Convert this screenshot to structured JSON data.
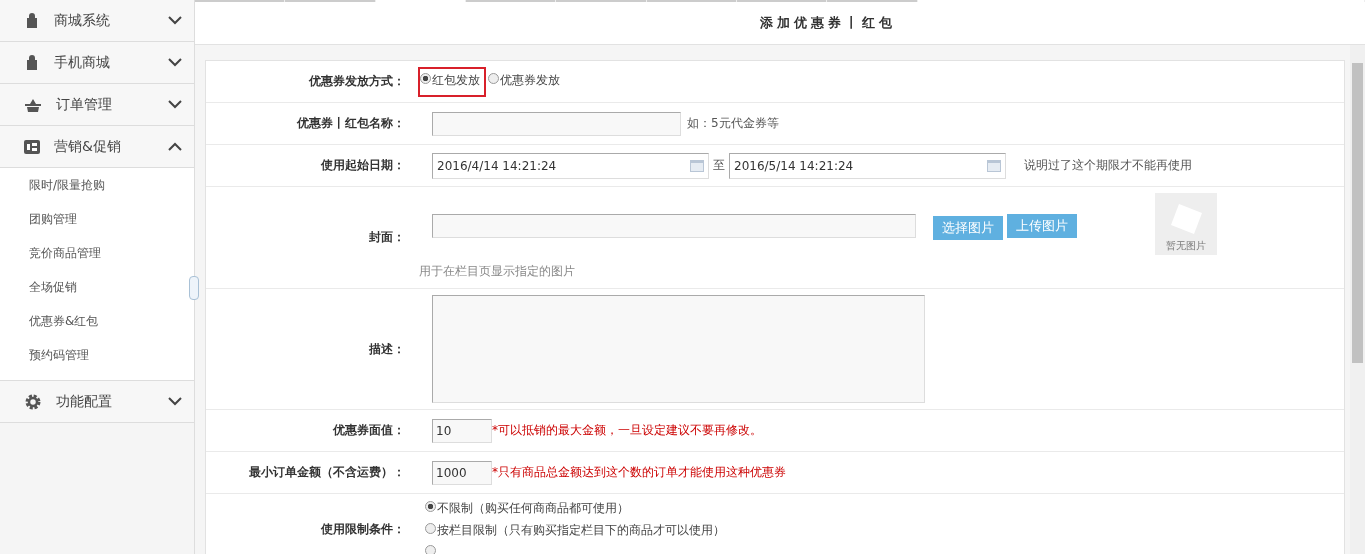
{
  "sidebar": {
    "groups": [
      {
        "label": "商城系统",
        "kind": "bag",
        "expanded": false
      },
      {
        "label": "手机商城",
        "kind": "bag",
        "expanded": false
      },
      {
        "label": "订单管理",
        "kind": "basket",
        "expanded": false
      },
      {
        "label": "营销&促销",
        "kind": "card",
        "expanded": true,
        "children": [
          {
            "label": "限时/限量抢购"
          },
          {
            "label": "团购管理"
          },
          {
            "label": "竞价商品管理"
          },
          {
            "label": "全场促销"
          },
          {
            "label": "优惠券&红包"
          },
          {
            "label": "预约码管理"
          }
        ]
      },
      {
        "label": "功能配置",
        "kind": "gear",
        "expanded": false
      }
    ]
  },
  "page_title": "添加优惠券丨红包",
  "form": [
    {
      "kind": "radio",
      "label": "优惠券发放方式：",
      "options": [
        {
          "label": "红包发放",
          "selected": true,
          "highlighted": true
        },
        {
          "label": "优惠券发放",
          "selected": false,
          "highlighted": false
        }
      ]
    },
    {
      "kind": "text",
      "label": "优惠券丨红包名称：",
      "hint": "如：5元代金券等"
    },
    {
      "kind": "daterange",
      "label": "使用起始日期：",
      "from": "2016/4/14 14:21:24",
      "separator": "至",
      "to": "2016/5/14 14:21:24",
      "hint": "说明过了这个期限才不能再使用"
    },
    {
      "kind": "image",
      "label": "封面：",
      "buttons": [
        "选择图片",
        "上传图片"
      ],
      "preview": "暂无图片",
      "hint": "用于在栏目页显示指定的图片"
    },
    {
      "kind": "textarea",
      "label": "描述："
    },
    {
      "kind": "amount",
      "label": "优惠券面值：",
      "value": "10",
      "hint": "*可以抵销的最大金额，一旦设定建议不要再修改。"
    },
    {
      "kind": "amount",
      "label": "最小订单金额（不含运费）：",
      "value": "1000",
      "hint": "*只有商品总金额达到这个数的订单才能使用这种优惠券"
    },
    {
      "kind": "radio_list",
      "label": "使用限制条件：",
      "options": [
        {
          "label": "不限制（购买任何商商品都可使用）",
          "selected": true
        },
        {
          "label": "按栏目限制（只有购买指定栏目下的商品才可以使用）",
          "selected": false
        },
        {
          "selected": false
        }
      ]
    }
  ]
}
